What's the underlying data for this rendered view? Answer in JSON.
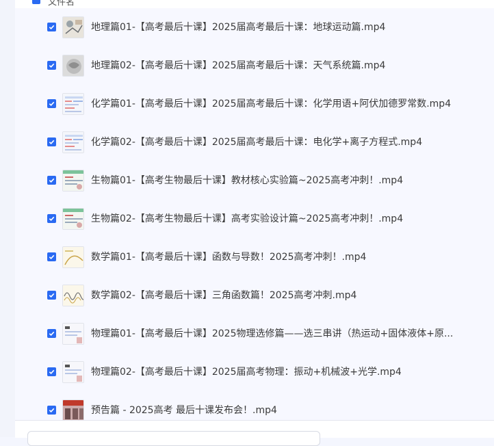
{
  "header": {
    "label": "文件名"
  },
  "files": [
    {
      "name": "地理篇01-【高考最后十课】2025届高考最后十课：地球运动篇.mp4",
      "checked": true,
      "thumb": "geo-thumb"
    },
    {
      "name": "地理篇02-【高考最后十课】2025届高考最后十课：天气系统篇.mp4",
      "checked": true,
      "thumb": "weather-thumb"
    },
    {
      "name": "化学篇01-【高考最后十课】2025届高考最后十课：化学用语+阿伏加德罗常数.mp4",
      "checked": true,
      "thumb": "chem-thumb"
    },
    {
      "name": "化学篇02-【高考最后十课】2025届高考最后十课：电化学+离子方程式.mp4",
      "checked": true,
      "thumb": "chem-thumb"
    },
    {
      "name": "生物篇01-【高考生物最后十课】教材核心实验篇~2025高考冲刺！.mp4",
      "checked": true,
      "thumb": "bio-thumb"
    },
    {
      "name": "生物篇02-【高考生物最后十课】高考实验设计篇~2025高考冲刺！.mp4",
      "checked": true,
      "thumb": "bio-thumb"
    },
    {
      "name": "数学篇01-【高考最后十课】函数与导数！2025高考冲刺！.mp4",
      "checked": true,
      "thumb": "math-thumb"
    },
    {
      "name": "数学篇02-【高考最后十课】三角函数篇！2025高考冲刺.mp4",
      "checked": true,
      "thumb": "math-wave-thumb"
    },
    {
      "name": "物理篇01-【高考最后十课】2025物理选修篇——选三串讲（热运动+固体液体+原...",
      "checked": true,
      "thumb": "phys-thumb"
    },
    {
      "name": "物理篇02-【高考最后十课】2025届高考物理：振动+机械波+光学.mp4",
      "checked": true,
      "thumb": "phys-thumb"
    },
    {
      "name": "预告篇 - 2025高考 最后十课发布会！.mp4",
      "checked": true,
      "thumb": "preview-thumb"
    }
  ],
  "colors": {
    "accent": "#2a6af2",
    "panel": "#f7f8ff"
  }
}
